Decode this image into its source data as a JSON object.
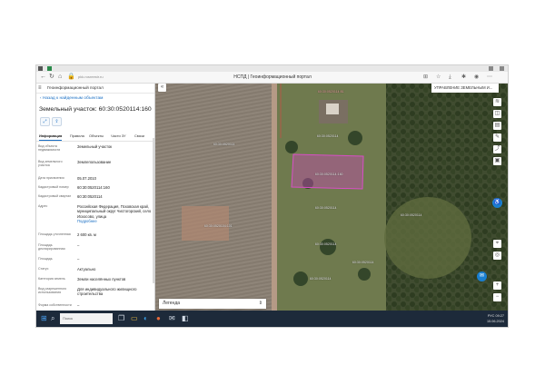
{
  "browser": {
    "url": "pkk.rosreestr.ru",
    "title": "НСПД | Геоинформационный портал"
  },
  "panel": {
    "portal_title": "Геоинформационный портал",
    "back_link": "Назад к найденным объектам",
    "object_title": "Земельный участок: 60:30:0520114:160",
    "tabs": [
      "Информация",
      "Правила",
      "Объекты",
      "Части ЗУ",
      "Связи"
    ],
    "properties": [
      {
        "label": "Вид объекта недвижимости",
        "value": "Земельный участок"
      },
      {
        "label": "Вид земельного участка",
        "value": "Землепользование"
      },
      {
        "label": "Дата присвоения",
        "value": "05.07.2010"
      },
      {
        "label": "Кадастровый номер",
        "value": "60:30:0520114:160"
      },
      {
        "label": "Кадастровый квартал",
        "value": "60:30:0520114"
      },
      {
        "label": "Адрес",
        "value": "Российская Федерация, Псковская край, муниципальный округ Чистогорский, село Искосово, улица",
        "more": "Подробнее"
      },
      {
        "label": "Площадь уточненная",
        "value": "2 600 кв. м"
      },
      {
        "label": "Площадь декларированная",
        "value": "–"
      },
      {
        "label": "Площадь",
        "value": "–"
      },
      {
        "label": "Статус",
        "value": "Актуально"
      },
      {
        "label": "Категория земель",
        "value": "Земли населённых пунктов"
      },
      {
        "label": "Вид разрешенного использования",
        "value": "Для индивидуального жилищного строительства"
      },
      {
        "label": "Форма собственности",
        "value": "–"
      }
    ]
  },
  "map": {
    "layer_select": "УПРАВЛЕНИЕ ЗЕМЕЛЬНЫМ И...",
    "legend": "Легенда",
    "labels": {
      "top": "60:30:0520114",
      "red": "60:30:0520114:81",
      "plot": "60:30:0520114:160",
      "field": "60:30:0520104:101",
      "mid1": "60:30:0520114",
      "mid2": "60:30:0520114",
      "right": "60:30:0520114",
      "lower1": "60:30:0520114",
      "lower2": "60:30:0520114",
      "small": "60:30:0520114"
    }
  },
  "taskbar": {
    "search_placeholder": "Поиск",
    "tray_lang": "РУС",
    "tray_time": "09:27",
    "tray_date": "15.06.2024"
  }
}
